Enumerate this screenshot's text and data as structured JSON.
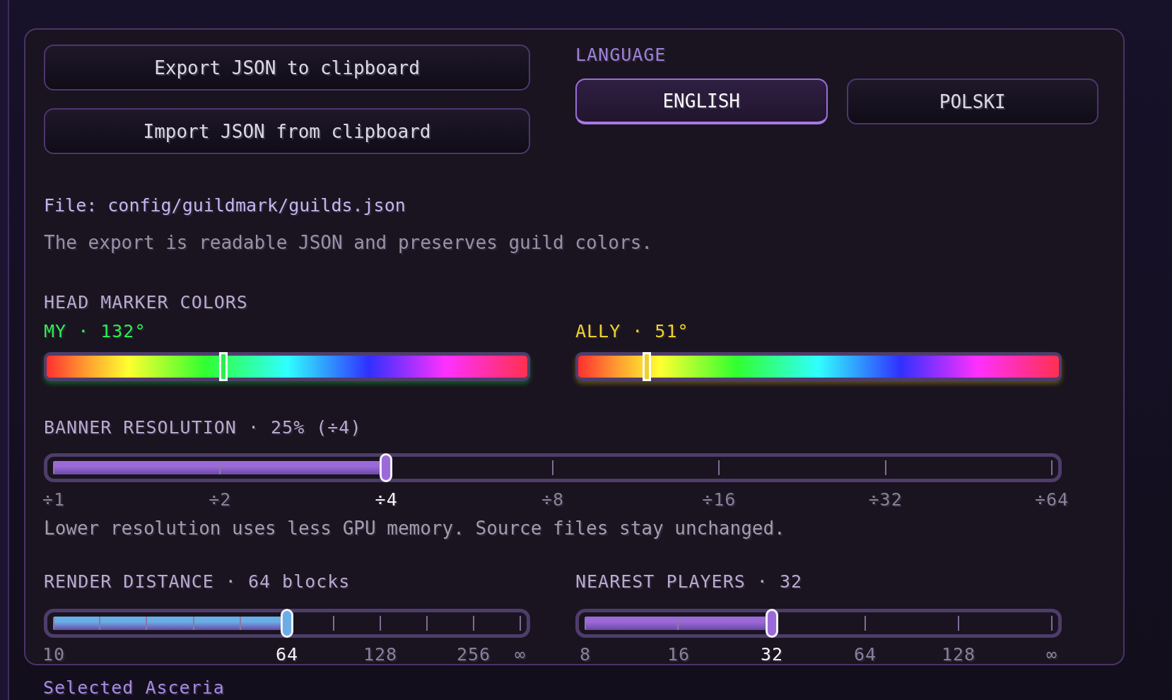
{
  "clipboard_buttons": [
    {
      "label": "Export JSON to clipboard"
    },
    {
      "label": "Import JSON from clipboard"
    }
  ],
  "language": {
    "title": "LANGUAGE",
    "options": [
      {
        "label": "ENGLISH",
        "selected": true
      },
      {
        "label": "POLSKI",
        "selected": false
      }
    ]
  },
  "file_path": "File: config/guildmark/guilds.json",
  "export_note": "The export is readable JSON and preserves guild colors.",
  "head_marker_colors": {
    "title": "HEAD MARKER COLORS",
    "sliders": [
      {
        "label": "MY · 132°",
        "level": 0.367
      },
      {
        "label": "ALLY · 51°",
        "level": 0.142
      }
    ]
  },
  "sliders": [
    {
      "label": "BANNER RESOLUTION · 25% (÷4)",
      "color": "#9c6ad8",
      "level": 0.333,
      "ticks": [
        {
          "kind": "major",
          "label": "÷1",
          "selected": false
        },
        {
          "kind": "major",
          "label": "÷2",
          "selected": false
        },
        {
          "kind": "major",
          "label": "÷4",
          "selected": true
        },
        {
          "kind": "major",
          "label": "÷8",
          "selected": false
        },
        {
          "kind": "major",
          "label": "÷16",
          "selected": false
        },
        {
          "kind": "major",
          "label": "÷32",
          "selected": false
        },
        {
          "kind": "major",
          "label": "÷64",
          "selected": false
        }
      ],
      "note": "Lower resolution uses less GPU memory. Source files stay unchanged."
    },
    {
      "label": "RENDER DISTANCE · 64 blocks",
      "color": "#6aaee6",
      "level": 0.5,
      "ticks": [
        {
          "kind": "major",
          "label": "10",
          "selected": false
        },
        {
          "kind": "minor",
          "selected": false
        },
        {
          "kind": "minor",
          "selected": false
        },
        {
          "kind": "minor",
          "selected": false
        },
        {
          "kind": "minor",
          "selected": false
        },
        {
          "kind": "major",
          "label": "64",
          "selected": true
        },
        {
          "kind": "minor",
          "selected": false
        },
        {
          "kind": "major",
          "label": "128",
          "selected": false
        },
        {
          "kind": "minor",
          "selected": false
        },
        {
          "kind": "major",
          "label": "256",
          "selected": false
        },
        {
          "kind": "major",
          "label": "∞",
          "selected": false
        }
      ]
    },
    {
      "label": "NEAREST PLAYERS · 32",
      "color": "#9c6ad8",
      "level": 0.4,
      "ticks": [
        {
          "kind": "major",
          "label": "8",
          "selected": false
        },
        {
          "kind": "major",
          "label": "16",
          "selected": false
        },
        {
          "kind": "major",
          "label": "32",
          "selected": true
        },
        {
          "kind": "major",
          "label": "64",
          "selected": false
        },
        {
          "kind": "major",
          "label": "128",
          "selected": false
        },
        {
          "kind": "major",
          "label": "∞",
          "selected": false
        }
      ]
    }
  ],
  "selected_guild": "Selected Asceria"
}
